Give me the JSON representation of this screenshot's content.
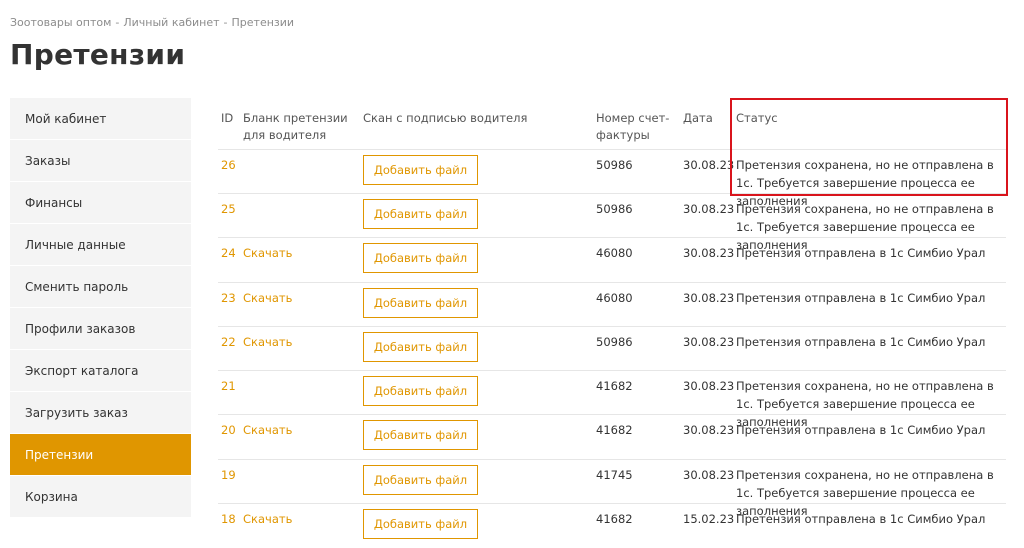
{
  "breadcrumb": [
    "Зоотовары оптом",
    "Личный кабинет",
    "Претензии"
  ],
  "breadcrumb_sep": "-",
  "page_title": "Претензии",
  "sidebar": {
    "items": [
      {
        "label": "Мой кабинет",
        "active": false
      },
      {
        "label": "Заказы",
        "active": false
      },
      {
        "label": "Финансы",
        "active": false
      },
      {
        "label": "Личные данные",
        "active": false
      },
      {
        "label": "Сменить пароль",
        "active": false
      },
      {
        "label": "Профили заказов",
        "active": false
      },
      {
        "label": "Экспорт каталога",
        "active": false
      },
      {
        "label": "Загрузить заказ",
        "active": false
      },
      {
        "label": "Претензии",
        "active": true
      },
      {
        "label": "Корзина",
        "active": false
      }
    ]
  },
  "table": {
    "headers": {
      "id": "ID",
      "blank": "Бланк претензии для водителя",
      "scan": "Скан с подписью водителя",
      "invoice": "Номер счет-фактуры",
      "date": "Дата",
      "status": "Статус"
    },
    "add_file_label": "Добавить файл",
    "download_label": "Скачать",
    "rows": [
      {
        "id": "26",
        "has_download": false,
        "invoice": "50986",
        "date": "30.08.23",
        "status": "Претензия сохранена, но не отправлена в 1с. Требуется завершение процесса ее заполнения"
      },
      {
        "id": "25",
        "has_download": false,
        "invoice": "50986",
        "date": "30.08.23",
        "status": "Претензия сохранена, но не отправлена в 1с. Требуется завершение процесса ее заполнения"
      },
      {
        "id": "24",
        "has_download": true,
        "invoice": "46080",
        "date": "30.08.23",
        "status": "Претензия отправлена в 1с Симбио Урал"
      },
      {
        "id": "23",
        "has_download": true,
        "invoice": "46080",
        "date": "30.08.23",
        "status": "Претензия отправлена в 1с Симбио Урал"
      },
      {
        "id": "22",
        "has_download": true,
        "invoice": "50986",
        "date": "30.08.23",
        "status": "Претензия отправлена в 1с Симбио Урал"
      },
      {
        "id": "21",
        "has_download": false,
        "invoice": "41682",
        "date": "30.08.23",
        "status": "Претензия сохранена, но не отправлена в 1с. Требуется завершение процесса ее заполнения"
      },
      {
        "id": "20",
        "has_download": true,
        "invoice": "41682",
        "date": "30.08.23",
        "status": "Претензия отправлена в 1с Симбио Урал"
      },
      {
        "id": "19",
        "has_download": false,
        "invoice": "41745",
        "date": "30.08.23",
        "status": "Претензия сохранена, но не отправлена в 1с. Требуется завершение процесса ее заполнения"
      },
      {
        "id": "18",
        "has_download": true,
        "invoice": "41682",
        "date": "15.02.23",
        "status": "Претензия отправлена в 1с Симбио Урал"
      }
    ]
  },
  "colors": {
    "accent": "#e09600",
    "highlight_box": "#d9141c",
    "sidebar_bg": "#f4f4f4"
  }
}
